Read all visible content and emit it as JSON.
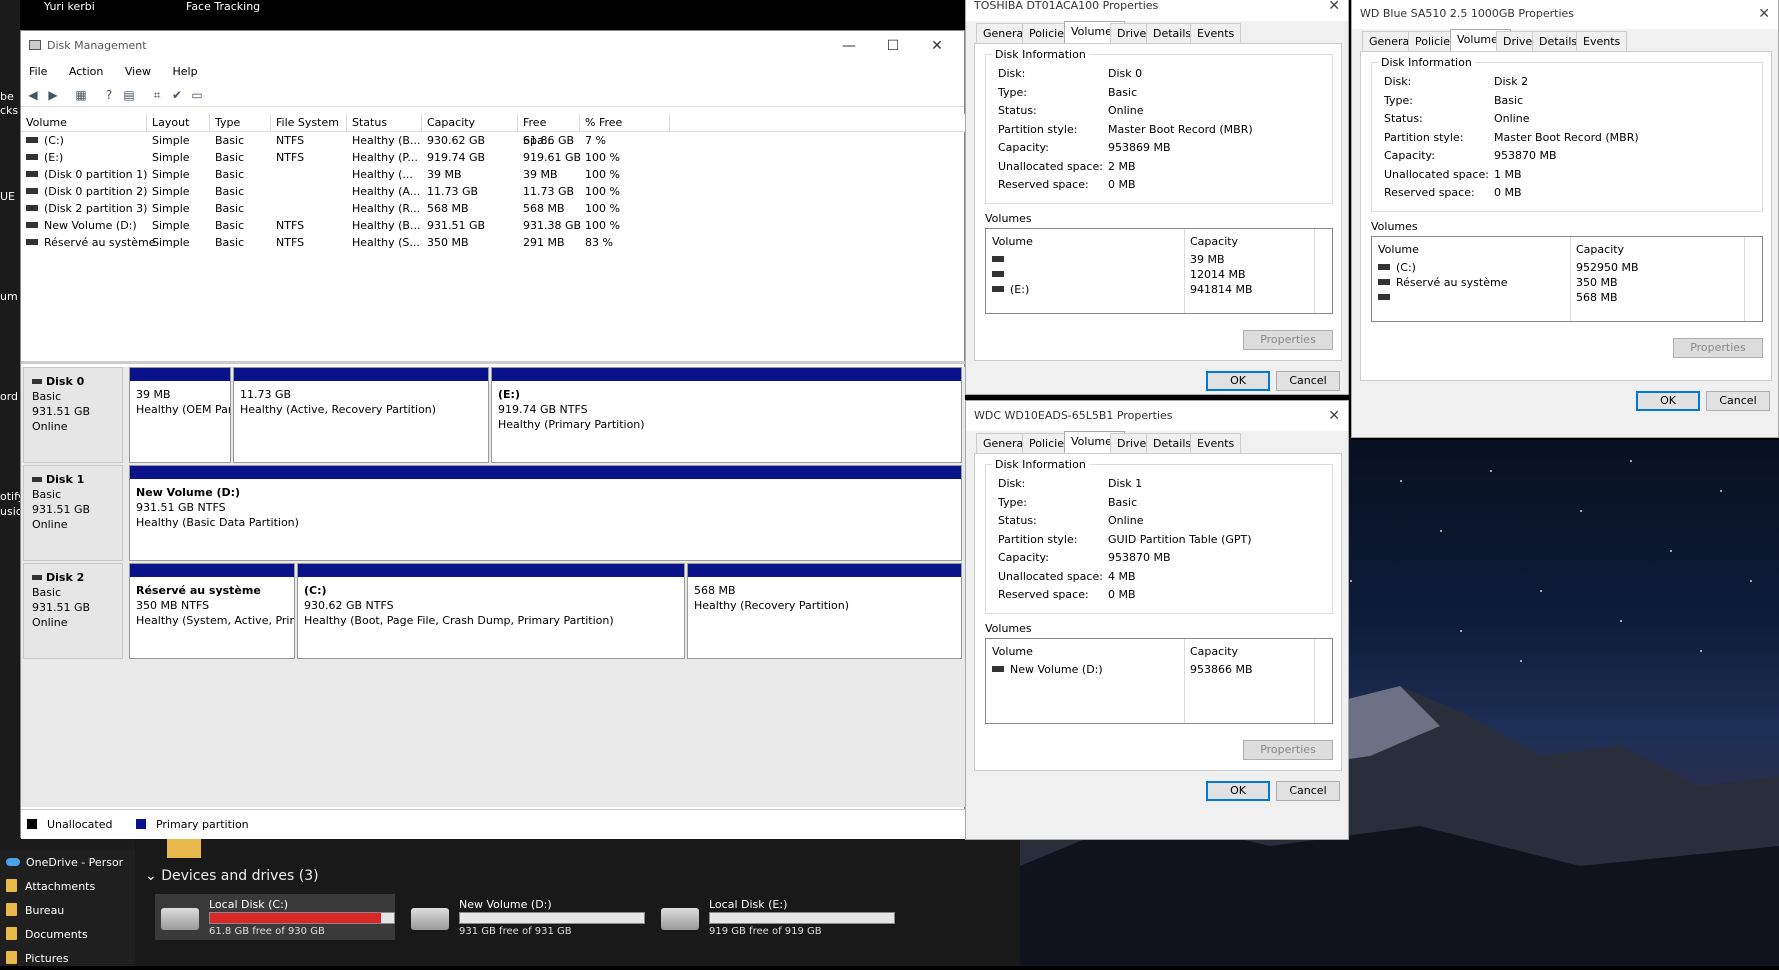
{
  "desktop": {
    "left_fragments": [
      "be",
      "cks",
      "UE",
      "um",
      "ord",
      "otify",
      "usic"
    ],
    "top_fragments": [
      "Yuri kerbi",
      "Face Tracking"
    ]
  },
  "disk_management": {
    "title": "Disk Management",
    "menu": [
      "File",
      "Action",
      "View",
      "Help"
    ],
    "columns": [
      "Volume",
      "Layout",
      "Type",
      "File System",
      "Status",
      "Capacity",
      "Free Spa...",
      "% Free"
    ],
    "rows": [
      [
        "(C:)",
        "Simple",
        "Basic",
        "NTFS",
        "Healthy (B...",
        "930.62 GB",
        "61.86 GB",
        "7 %"
      ],
      [
        "(E:)",
        "Simple",
        "Basic",
        "NTFS",
        "Healthy (P...",
        "919.74 GB",
        "919.61 GB",
        "100 %"
      ],
      [
        "(Disk 0 partition 1)",
        "Simple",
        "Basic",
        "",
        "Healthy (...",
        "39 MB",
        "39 MB",
        "100 %"
      ],
      [
        "(Disk 0 partition 2)",
        "Simple",
        "Basic",
        "",
        "Healthy (A...",
        "11.73 GB",
        "11.73 GB",
        "100 %"
      ],
      [
        "(Disk 2 partition 3)",
        "Simple",
        "Basic",
        "",
        "Healthy (R...",
        "568 MB",
        "568 MB",
        "100 %"
      ],
      [
        "New Volume (D:)",
        "Simple",
        "Basic",
        "NTFS",
        "Healthy (B...",
        "931.51 GB",
        "931.38 GB",
        "100 %"
      ],
      [
        "Réservé au système",
        "Simple",
        "Basic",
        "NTFS",
        "Healthy (S...",
        "350 MB",
        "291 MB",
        "83 %"
      ]
    ],
    "disks": [
      {
        "name": "Disk 0",
        "type": "Basic",
        "size": "931.51 GB",
        "status": "Online",
        "partitions": [
          {
            "name": "",
            "size": "39 MB",
            "health": "Healthy (OEM Part"
          },
          {
            "name": "",
            "size": "11.73 GB",
            "health": "Healthy (Active, Recovery Partition)"
          },
          {
            "name": "(E:)",
            "size": "919.74 GB NTFS",
            "health": "Healthy (Primary Partition)"
          }
        ]
      },
      {
        "name": "Disk 1",
        "type": "Basic",
        "size": "931.51 GB",
        "status": "Online",
        "partitions": [
          {
            "name": "New Volume  (D:)",
            "size": "931.51 GB NTFS",
            "health": "Healthy (Basic Data Partition)"
          }
        ]
      },
      {
        "name": "Disk 2",
        "type": "Basic",
        "size": "931.51 GB",
        "status": "Online",
        "partitions": [
          {
            "name": "Réservé au système",
            "size": "350 MB NTFS",
            "health": "Healthy (System, Active, Primary"
          },
          {
            "name": "(C:)",
            "size": "930.62 GB NTFS",
            "health": "Healthy (Boot, Page File, Crash Dump, Primary Partition)"
          },
          {
            "name": "",
            "size": "568 MB",
            "health": "Healthy (Recovery Partition)"
          }
        ]
      }
    ],
    "legend": {
      "unallocated": "Unallocated",
      "primary": "Primary partition",
      "unallocated_color": "#000000",
      "primary_color": "#0a128a"
    }
  },
  "tabs": [
    "General",
    "Policies",
    "Volumes",
    "Driver",
    "Details",
    "Events"
  ],
  "labels": {
    "disk_information": "Disk Information",
    "disk": "Disk:",
    "type": "Type:",
    "status": "Status:",
    "partition_style": "Partition style:",
    "capacity": "Capacity:",
    "unallocated": "Unallocated space:",
    "reserved": "Reserved space:",
    "volumes": "Volumes",
    "col_volume": "Volume",
    "col_capacity": "Capacity",
    "properties": "Properties",
    "ok": "OK",
    "cancel": "Cancel"
  },
  "dialog_toshiba": {
    "title": "TOSHIBA DT01ACA100 Properties",
    "disk": "Disk 0",
    "type": "Basic",
    "status": "Online",
    "partition_style": "Master Boot Record (MBR)",
    "capacity": "953869 MB",
    "unallocated": "2 MB",
    "reserved": "0 MB",
    "volumes": [
      {
        "name": "",
        "cap": "39 MB"
      },
      {
        "name": "",
        "cap": "12014 MB"
      },
      {
        "name": "(E:)",
        "cap": "941814 MB"
      }
    ]
  },
  "dialog_wdc": {
    "title": "WDC WD10EADS-65L5B1 Properties",
    "disk": "Disk 1",
    "type": "Basic",
    "status": "Online",
    "partition_style": "GUID Partition Table (GPT)",
    "capacity": "953870 MB",
    "unallocated": "4 MB",
    "reserved": "0 MB",
    "volumes": [
      {
        "name": "New Volume (D:)",
        "cap": "953866 MB"
      }
    ]
  },
  "dialog_wdblue": {
    "title": "WD Blue SA510 2.5 1000GB Properties",
    "disk": "Disk 2",
    "type": "Basic",
    "status": "Online",
    "partition_style": "Master Boot Record (MBR)",
    "capacity": "953870 MB",
    "unallocated": "1 MB",
    "reserved": "0 MB",
    "volumes": [
      {
        "name": "(C:)",
        "cap": "952950 MB"
      },
      {
        "name": "Réservé au système",
        "cap": "350 MB"
      },
      {
        "name": "",
        "cap": "568 MB"
      }
    ]
  },
  "explorer": {
    "nav": [
      "OneDrive - Persor",
      "Attachments",
      "Bureau",
      "Documents",
      "Pictures"
    ],
    "devices_header": "Devices and drives (3)",
    "drives": [
      {
        "name": "Local Disk (C:)",
        "free": "61.8 GB free of 930 GB",
        "used_fraction": 0.93
      },
      {
        "name": "New Volume (D:)",
        "free": "931 GB free of 931 GB",
        "used_fraction": 0.0
      },
      {
        "name": "Local Disk (E:)",
        "free": "919 GB free of 919 GB",
        "used_fraction": 0.0
      }
    ]
  }
}
